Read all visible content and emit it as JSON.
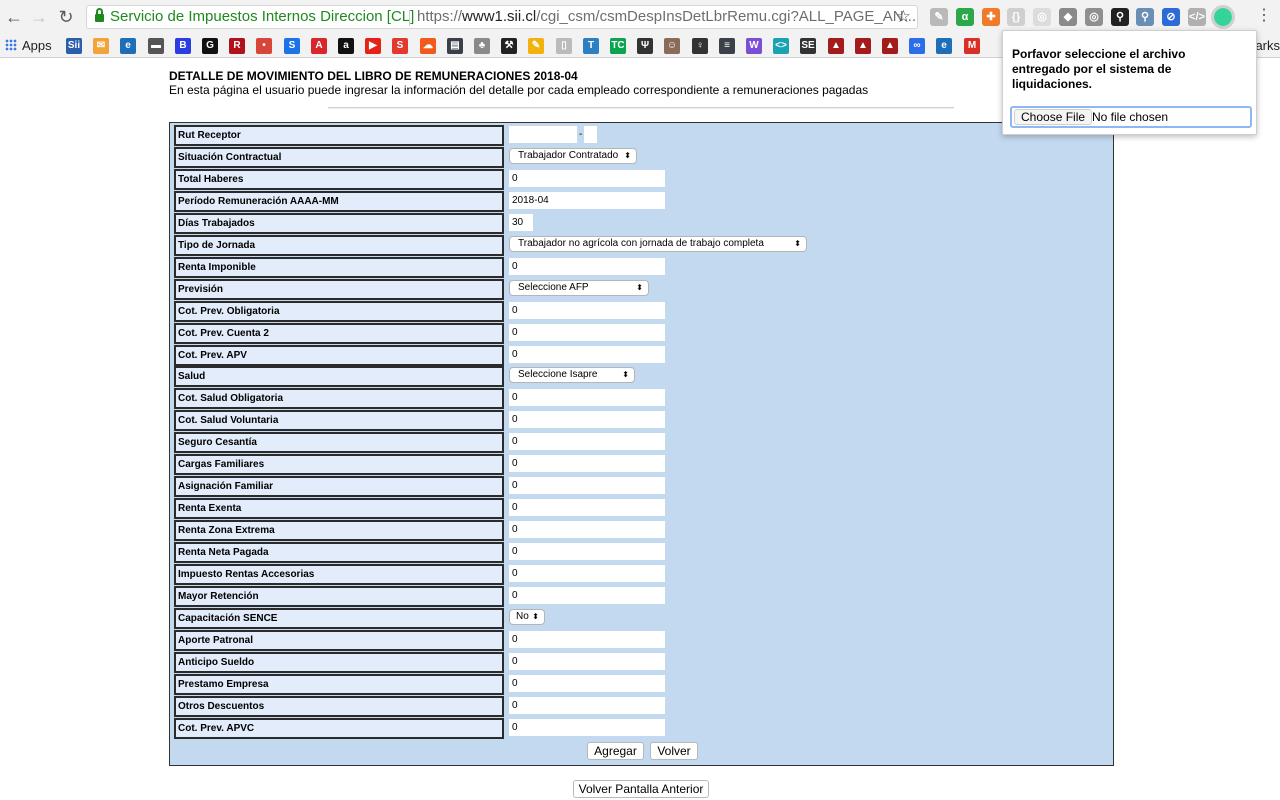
{
  "browser": {
    "site_name": "Servicio de Impuestos Internos Direccion [CL]",
    "url_scheme": "https://",
    "url_host": "www1.sii.cl",
    "url_path": "/cgi_csm/csmDespInsDetLbrRemu.cgi?ALL_PAGE_AN...",
    "bookmarks_apps_label": "Apps",
    "bookmarks_overflow_label": "arks",
    "extensions": [
      {
        "name": "note-icon",
        "color": "#b9b9b9",
        "glyph": "✎"
      },
      {
        "name": "avast-icon",
        "color": "#2aa84a",
        "glyph": "α"
      },
      {
        "name": "lifebuoy-icon",
        "color": "#f07a2a",
        "glyph": "✚"
      },
      {
        "name": "json-icon",
        "color": "#cfcfcf",
        "glyph": "{}"
      },
      {
        "name": "camera-light-icon",
        "color": "#dcdcdc",
        "glyph": "◎"
      },
      {
        "name": "shield-icon",
        "color": "#8a8a8a",
        "glyph": "◆"
      },
      {
        "name": "camera-icon",
        "color": "#8f8f8f",
        "glyph": "◎"
      },
      {
        "name": "network-icon",
        "color": "#222222",
        "glyph": "⚲"
      },
      {
        "name": "magnifier-icon",
        "color": "#6a8fb5",
        "glyph": "⚲"
      },
      {
        "name": "block-icon",
        "color": "#2c6bd6",
        "glyph": "⊘"
      },
      {
        "name": "code-icon",
        "color": "#b0b0b0",
        "glyph": "</>"
      },
      {
        "name": "grammarly-icon",
        "color": "#34d399",
        "glyph": "●"
      }
    ],
    "bookmarks": [
      {
        "name": "sii-bookmark-icon",
        "color": "#2a5ea8",
        "glyph": "Sii"
      },
      {
        "name": "mail-bookmark-icon",
        "color": "#f2a33a",
        "glyph": "✉"
      },
      {
        "name": "e-bookmark-icon",
        "color": "#1e6fb8",
        "glyph": "e"
      },
      {
        "name": "bbc-bookmark-icon",
        "color": "#555555",
        "glyph": "▬"
      },
      {
        "name": "b-bookmark-icon",
        "color": "#2b3de0",
        "glyph": "B"
      },
      {
        "name": "g-bookmark-icon",
        "color": "#111111",
        "glyph": "G"
      },
      {
        "name": "r-bookmark-icon",
        "color": "#b0121b",
        "glyph": "R"
      },
      {
        "name": "cnn-bookmark-icon",
        "color": "#d8463a",
        "glyph": "•"
      },
      {
        "name": "swirl-bookmark-icon",
        "color": "#1b73e8",
        "glyph": "S"
      },
      {
        "name": "adobe-bookmark-icon",
        "color": "#d7262c",
        "glyph": "A"
      },
      {
        "name": "a-bookmark-icon",
        "color": "#111111",
        "glyph": "a"
      },
      {
        "name": "youtube-bookmark-icon",
        "color": "#e62117",
        "glyph": "▶"
      },
      {
        "name": "s-bookmark-icon",
        "color": "#e23b2e",
        "glyph": "S"
      },
      {
        "name": "soundcloud-bookmark-icon",
        "color": "#f25a1b",
        "glyph": "☁"
      },
      {
        "name": "credits-bookmark-icon",
        "color": "#3b3f47",
        "glyph": "▤"
      },
      {
        "name": "crest-bookmark-icon",
        "color": "#8a8a8a",
        "glyph": "♣"
      },
      {
        "name": "hammer-bookmark-icon",
        "color": "#222222",
        "glyph": "⚒"
      },
      {
        "name": "pencil-bookmark-icon",
        "color": "#f1b20e",
        "glyph": "✎"
      },
      {
        "name": "page-bookmark-icon",
        "color": "#bbbbbb",
        "glyph": "▯"
      },
      {
        "name": "tz-bookmark-icon",
        "color": "#2c7fc0",
        "glyph": "T"
      },
      {
        "name": "techcrunch-bookmark-icon",
        "color": "#0aa34f",
        "glyph": "TC"
      },
      {
        "name": "wreath-bookmark-icon",
        "color": "#333333",
        "glyph": "Ψ"
      },
      {
        "name": "person-photo-bookmark-icon",
        "color": "#8a6b5a",
        "glyph": "☺"
      },
      {
        "name": "bulb-bookmark-icon",
        "color": "#333333",
        "glyph": "♀"
      },
      {
        "name": "calc-bookmark-icon",
        "color": "#3a4148",
        "glyph": "≡"
      },
      {
        "name": "w-bookmark-icon",
        "color": "#7a4fd6",
        "glyph": "W"
      },
      {
        "name": "brackets-bookmark-icon",
        "color": "#19a3b0",
        "glyph": "<>"
      },
      {
        "name": "sej-bookmark-icon",
        "color": "#333333",
        "glyph": "SE"
      },
      {
        "name": "user-red-1-bookmark-icon",
        "color": "#a31c1c",
        "glyph": "▲"
      },
      {
        "name": "user-red-2-bookmark-icon",
        "color": "#a31c1c",
        "glyph": "▲"
      },
      {
        "name": "user-red-3-bookmark-icon",
        "color": "#a31c1c",
        "glyph": "▲"
      },
      {
        "name": "infinity-bookmark-icon",
        "color": "#2c6ee8",
        "glyph": "∞"
      },
      {
        "name": "e2-bookmark-icon",
        "color": "#1e6fb8",
        "glyph": "e"
      },
      {
        "name": "gmail-bookmark-icon",
        "color": "#d93025",
        "glyph": "M"
      }
    ]
  },
  "page": {
    "title": "DETALLE DE MOVIMIENTO DEL LIBRO DE REMUNERACIONES 2018-04",
    "description": "En esta página el usuario puede ingresar la información del detalle por cada empleado correspondiente a remuneraciones pagadas",
    "fields": [
      {
        "label": "Rut Receptor",
        "type": "rut",
        "value": "",
        "dv": ""
      },
      {
        "label": "Situación Contractual",
        "type": "select",
        "value": "Trabajador Contratado"
      },
      {
        "label": "Total Haberes",
        "type": "input",
        "value": "0"
      },
      {
        "label": "Período Remuneración AAAA-MM",
        "type": "input",
        "value": "2018-04"
      },
      {
        "label": "Días Trabajados",
        "type": "input-small",
        "value": "30"
      },
      {
        "label": "Tipo de Jornada",
        "type": "select",
        "value": "Trabajador no agrícola con jornada de trabajo completa"
      },
      {
        "label": "Renta Imponible",
        "type": "input",
        "value": "0"
      },
      {
        "label": "Previsión",
        "type": "select",
        "value": "Seleccione AFP"
      },
      {
        "label": "Cot. Prev. Obligatoria",
        "type": "input",
        "value": "0"
      },
      {
        "label": "Cot. Prev. Cuenta 2",
        "type": "input",
        "value": "0"
      },
      {
        "label": "Cot. Prev. APV",
        "type": "input",
        "value": "0"
      },
      {
        "label": "Salud",
        "type": "select",
        "value": "Seleccione Isapre"
      },
      {
        "label": "Cot. Salud Obligatoria",
        "type": "input",
        "value": "0"
      },
      {
        "label": "Cot. Salud Voluntaria",
        "type": "input",
        "value": "0"
      },
      {
        "label": "Seguro Cesantía",
        "type": "input",
        "value": "0"
      },
      {
        "label": "Cargas Familiares",
        "type": "input",
        "value": "0"
      },
      {
        "label": "Asignación Familiar",
        "type": "input",
        "value": "0"
      },
      {
        "label": "Renta Exenta",
        "type": "input",
        "value": "0"
      },
      {
        "label": "Renta Zona Extrema",
        "type": "input",
        "value": "0"
      },
      {
        "label": "Renta Neta Pagada",
        "type": "input",
        "value": "0"
      },
      {
        "label": "Impuesto Rentas Accesorias",
        "type": "input",
        "value": "0"
      },
      {
        "label": "Mayor Retención",
        "type": "input",
        "value": "0"
      },
      {
        "label": "Capacitación SENCE",
        "type": "select",
        "value": "No"
      },
      {
        "label": "Aporte Patronal",
        "type": "input",
        "value": "0"
      },
      {
        "label": "Anticipo Sueldo",
        "type": "input",
        "value": "0"
      },
      {
        "label": "Prestamo Empresa",
        "type": "input",
        "value": "0"
      },
      {
        "label": "Otros Descuentos",
        "type": "input",
        "value": "0"
      },
      {
        "label": "Cot. Prev. APVC",
        "type": "input",
        "value": "0"
      }
    ],
    "rut_separator": "-",
    "add_button": "Agregar",
    "back_button": "Volver",
    "previous_screen_button": "Volver Pantalla Anterior"
  },
  "popup": {
    "message": "Porfavor seleccione el archivo entregado por el sistema de liquidaciones.",
    "choose_file_label": "Choose File",
    "no_file_label": "No file chosen"
  }
}
